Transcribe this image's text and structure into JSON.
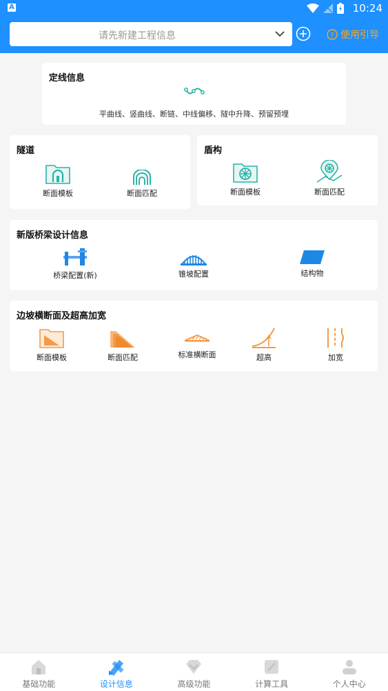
{
  "status": {
    "time": "10:24",
    "app_badge": "A"
  },
  "header": {
    "project_placeholder": "请先新建工程信息",
    "guide_label": "使用引导"
  },
  "alignment": {
    "title": "定线信息",
    "subtitle": "平曲线、竖曲线、断链、中线偏移、隧中升降、预留预埋"
  },
  "tunnel": {
    "title": "隧道",
    "items": [
      "断面模板",
      "断面匹配"
    ]
  },
  "shield": {
    "title": "盾构",
    "items": [
      "断面模板",
      "断面匹配"
    ]
  },
  "bridge": {
    "title": "新版桥梁设计信息",
    "items": [
      "桥梁配置(新)",
      "锥坡配置",
      "结构物"
    ]
  },
  "slope": {
    "title": "边坡横断面及超高加宽",
    "items": [
      "断面模板",
      "断面匹配",
      "标准横断面",
      "超高",
      "加宽"
    ]
  },
  "nav": {
    "tabs": [
      "基础功能",
      "设计信息",
      "高级功能",
      "计算工具",
      "个人中心"
    ],
    "active": "设计信息"
  },
  "colors": {
    "primary": "#1e90ff",
    "accent": "#f5a623",
    "teal": "#2bb3a6",
    "orange": "#f59a45"
  }
}
